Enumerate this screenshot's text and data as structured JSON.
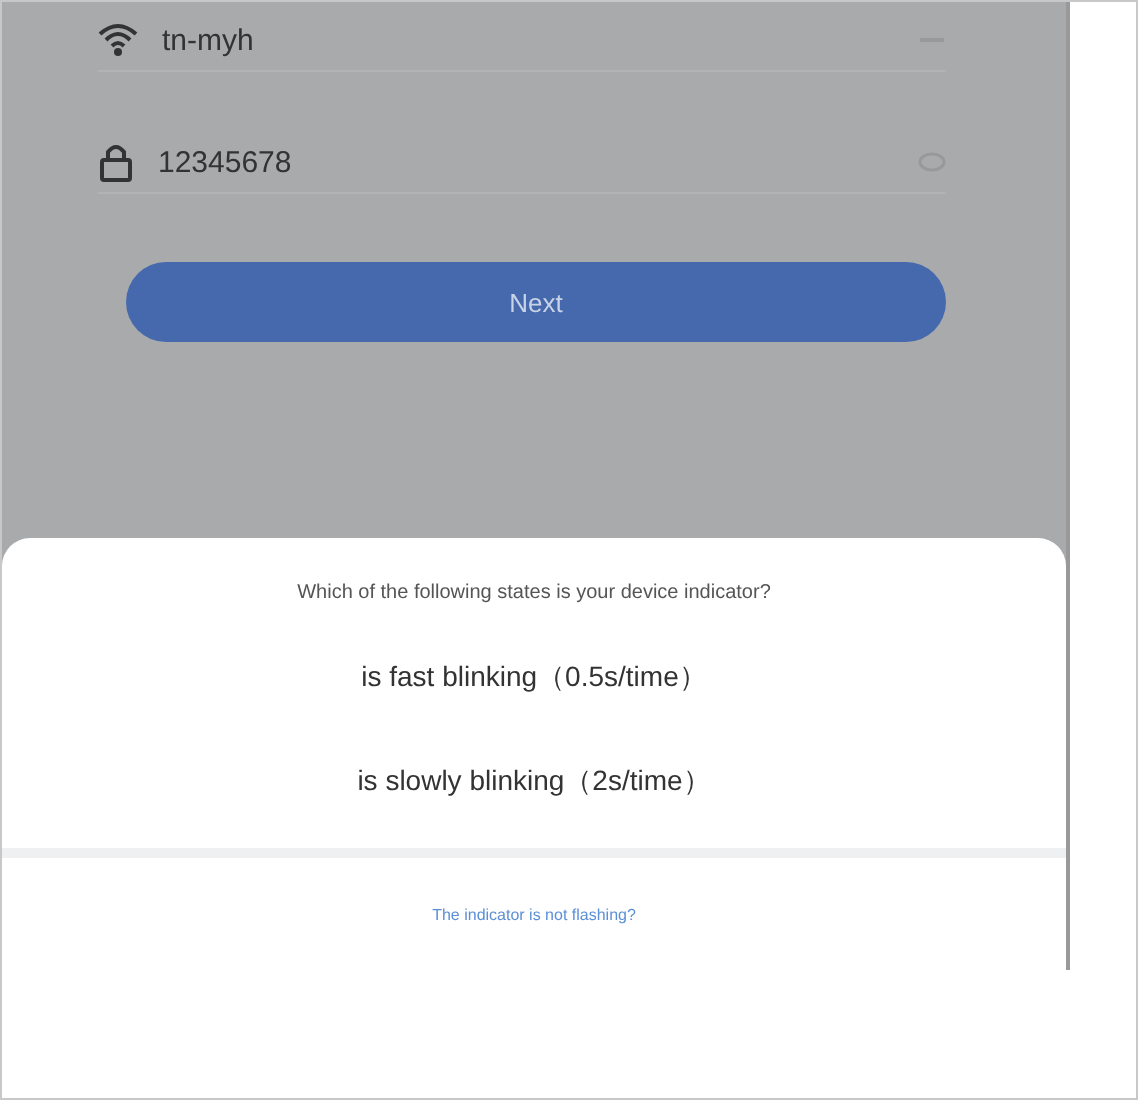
{
  "wifi_field": {
    "value": "tn-myh"
  },
  "password_field": {
    "value": "12345678"
  },
  "next_button": {
    "label": "Next"
  },
  "dialog": {
    "question": "Which of the following states is your device indicator?",
    "options": [
      {
        "label": "is fast blinking（0.5s/time）"
      },
      {
        "label": "is slowly blinking（2s/time）"
      }
    ],
    "link": "The indicator is not flashing?"
  }
}
